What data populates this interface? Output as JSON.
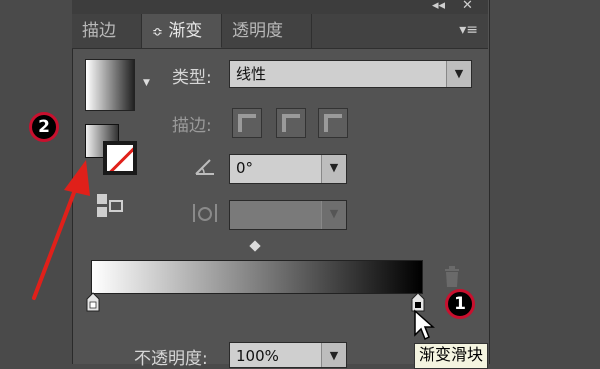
{
  "tabs": [
    {
      "label": "描边"
    },
    {
      "label": "渐变",
      "prefix": "≎"
    },
    {
      "label": "透明度"
    }
  ],
  "window_controls": {
    "collapse": "◂◂",
    "close": "✕",
    "menu": "▾≡"
  },
  "gradient": {
    "type_label": "类型:",
    "type_value": "线性",
    "stroke_label": "描边:",
    "angle_value": "0°",
    "opacity_label": "不透明度:",
    "opacity_value": "100%",
    "tooltip": "渐变滑块",
    "stops": [
      0,
      1
    ]
  },
  "annotations": [
    {
      "number": "1"
    },
    {
      "number": "2"
    }
  ],
  "colors": {
    "panel": "#535353",
    "arrow": "#e0201a",
    "badge_border": "#c8102e"
  }
}
